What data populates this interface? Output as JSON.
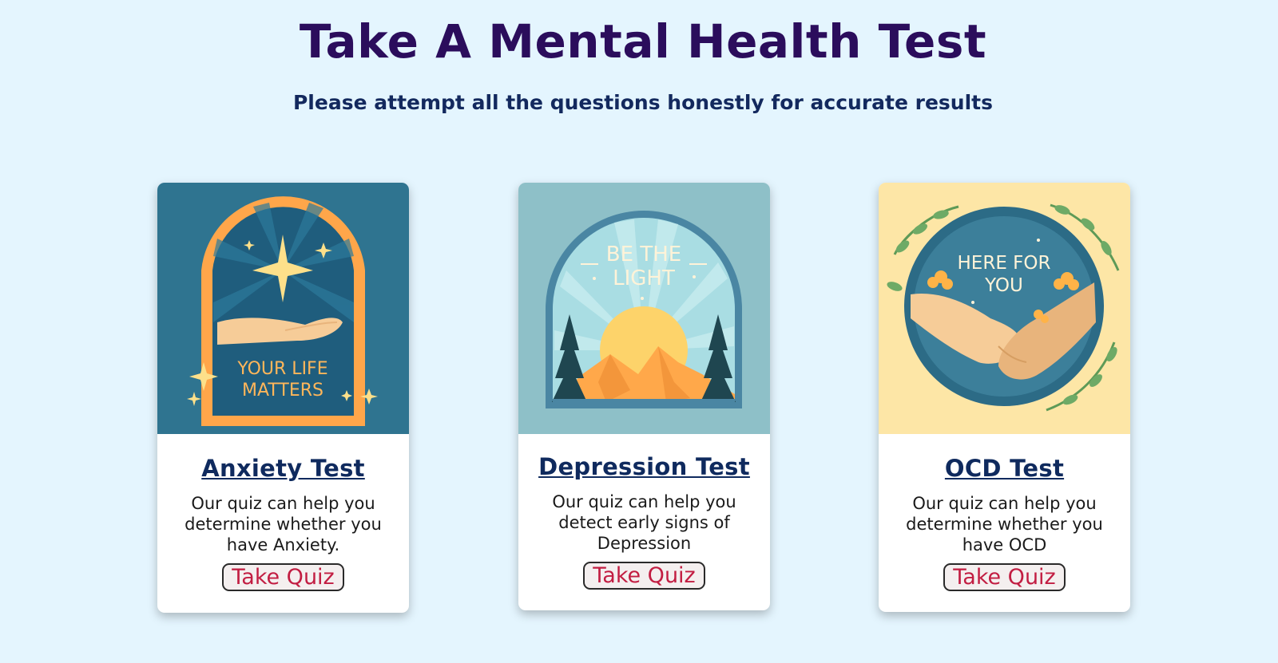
{
  "header": {
    "title": "Take A Mental Health Test",
    "subtitle": "Please attempt all the questions honestly for accurate results"
  },
  "cards": [
    {
      "title": "Anxiety Test",
      "description": "Our quiz can help you determine whether you have Anxiety.",
      "button": "Take Quiz",
      "art_line1": "YOUR LIFE",
      "art_line2": "MATTERS",
      "art_bg": "#2f7490"
    },
    {
      "title": "Depression Test",
      "description": "Our quiz can help you detect early signs of Depression",
      "button": "Take Quiz",
      "art_line1": "BE THE",
      "art_line2": "LIGHT",
      "art_bg": "#8ec0c8"
    },
    {
      "title": "OCD Test",
      "description": "Our quiz can help you determine whether you have OCD",
      "button": "Take Quiz",
      "art_line1": "HERE FOR",
      "art_line2": "YOU",
      "art_bg": "#fde6a6"
    }
  ],
  "colors": {
    "page_bg": "#e4f5fe",
    "title": "#2b0d5c",
    "subtitle": "#13295e",
    "button_text": "#c21d42"
  }
}
